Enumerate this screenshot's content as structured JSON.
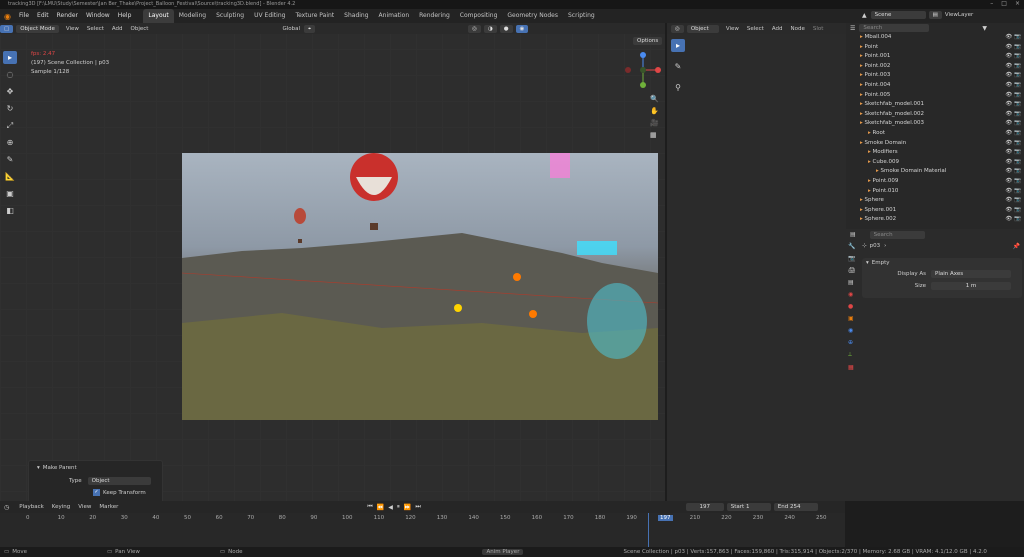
{
  "title": "tracking3D [F:\\LMU\\Study\\Semester\\Jan Ber_Thake\\Project_Balloon_Festival\\Source\\tracking3D.blend] - Blender 4.2",
  "menu": [
    "File",
    "Edit",
    "Render",
    "Window",
    "Help"
  ],
  "workspaces": [
    "Layout",
    "Modeling",
    "Sculpting",
    "UV Editing",
    "Texture Paint",
    "Shading",
    "Animation",
    "Rendering",
    "Compositing",
    "Geometry Nodes",
    "Scripting"
  ],
  "scene": "Scene",
  "view_layer": "ViewLayer",
  "viewport": {
    "mode": "Object Mode",
    "menus": [
      "View",
      "Select",
      "Add",
      "Object"
    ],
    "orientation": "Global",
    "options": "Options",
    "info": {
      "fps": "fps: 2.47",
      "collection": "(197) Scene Collection | p03",
      "sample": "Sample 1/128"
    }
  },
  "right_editor": {
    "type": "Object",
    "menus": [
      "View",
      "Select",
      "Add",
      "Node"
    ],
    "slot": "Slot"
  },
  "outliner": {
    "search": "Search",
    "items": [
      {
        "label": "Mball.004",
        "indent": 0
      },
      {
        "label": "Point",
        "indent": 0
      },
      {
        "label": "Point.001",
        "indent": 0
      },
      {
        "label": "Point.002",
        "indent": 0
      },
      {
        "label": "Point.003",
        "indent": 0
      },
      {
        "label": "Point.004",
        "indent": 0
      },
      {
        "label": "Point.005",
        "indent": 0
      },
      {
        "label": "Sketchfab_model.001",
        "indent": 0
      },
      {
        "label": "Sketchfab_model.002",
        "indent": 0
      },
      {
        "label": "Sketchfab_model.003",
        "indent": 0
      },
      {
        "label": "Root",
        "indent": 1
      },
      {
        "label": "Smoke Domain",
        "indent": 0
      },
      {
        "label": "Modifiers",
        "indent": 1
      },
      {
        "label": "Cube.009",
        "indent": 1
      },
      {
        "label": "Smoke Domain Material",
        "indent": 2
      },
      {
        "label": "Point.009",
        "indent": 1
      },
      {
        "label": "Point.010",
        "indent": 1
      },
      {
        "label": "Sphere",
        "indent": 0
      },
      {
        "label": "Sphere.001",
        "indent": 0
      },
      {
        "label": "Sphere.002",
        "indent": 0
      }
    ]
  },
  "properties": {
    "search": "Search",
    "object": "p03",
    "panel": "Empty",
    "display_as_label": "Display As",
    "display_as": "Plain Axes",
    "size_label": "Size",
    "size": "1 m"
  },
  "make_parent": {
    "title": "Make Parent",
    "type_label": "Type",
    "type": "Object",
    "keep_transform": "Keep Transform"
  },
  "timeline": {
    "menus": [
      "Playback",
      "Keying",
      "View",
      "Marker"
    ],
    "current": "197",
    "start_label": "Start",
    "start": "1",
    "end_label": "End",
    "end": "254",
    "ticks": [
      "0",
      "10",
      "20",
      "30",
      "40",
      "50",
      "60",
      "70",
      "80",
      "90",
      "100",
      "110",
      "120",
      "130",
      "140",
      "150",
      "160",
      "170",
      "180",
      "190",
      "197",
      "210",
      "220",
      "230",
      "240",
      "250"
    ]
  },
  "status": {
    "move": "Move",
    "pan": "Pan View",
    "node": "Node",
    "anim": "Anim Player",
    "stats": "Scene Collection | p03 | Verts:157,863 | Faces:159,860 | Tris:315,914 | Objects:2/370 | Memory: 2.68 GB | VRAM: 4.1/12.0 GB | 4.2.0"
  }
}
